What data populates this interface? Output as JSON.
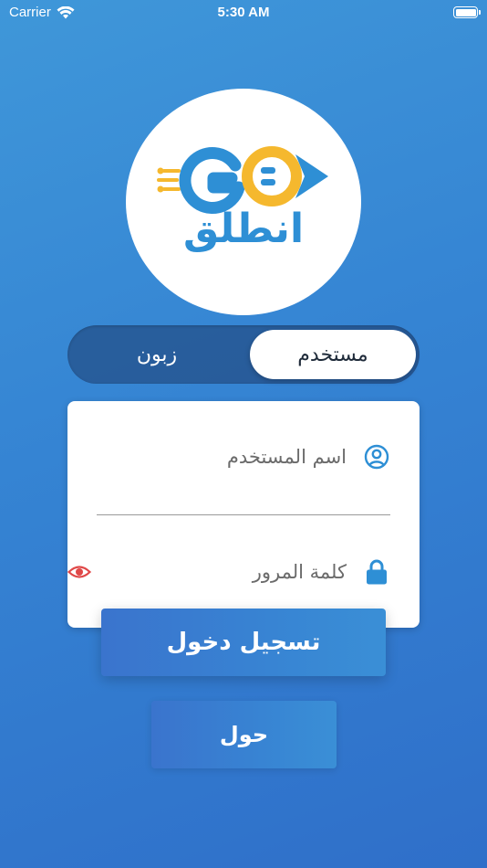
{
  "status_bar": {
    "carrier": "Carrier",
    "time": "5:30 AM"
  },
  "logo": {
    "latin_text": "GO",
    "arabic_text": "انطلق",
    "colors": {
      "primary_blue": "#2e8fd5",
      "accent_yellow": "#f5b82e"
    }
  },
  "toggle": {
    "options": [
      {
        "label": "مستخدم",
        "selected": true
      },
      {
        "label": "زبون",
        "selected": false
      }
    ]
  },
  "form": {
    "username": {
      "placeholder": "اسم المستخدم",
      "value": "",
      "icon": "user-circle-icon"
    },
    "password": {
      "placeholder": "كلمة المرور",
      "value": "",
      "icon": "lock-icon",
      "toggle_icon": "eye-icon"
    }
  },
  "buttons": {
    "login": "تسجيل دخول",
    "about": "حول"
  },
  "colors": {
    "background_start": "#3f97d9",
    "background_end": "#2f6fc9",
    "icon_blue": "#2e8fd5",
    "eye_red": "#e04848"
  }
}
